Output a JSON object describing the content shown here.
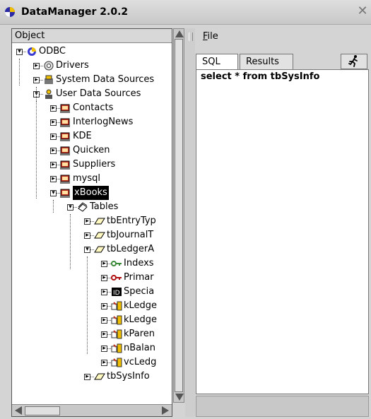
{
  "window": {
    "title": "DataManager 2.0.2",
    "close_glyph": "✕"
  },
  "tree": {
    "header": "Object",
    "nodes": [
      {
        "label": "ODBC",
        "icon": "odbc-globe-icon",
        "toggle": "−"
      },
      {
        "label": "Drivers",
        "icon": "drivers-gear-icon",
        "toggle": "+"
      },
      {
        "label": "System Data Sources",
        "icon": "system-datasource-icon",
        "toggle": "+"
      },
      {
        "label": "User Data Sources",
        "icon": "user-datasource-icon",
        "toggle": "−"
      },
      {
        "label": "Contacts",
        "icon": "database-icon",
        "toggle": "+"
      },
      {
        "label": "InterlogNews",
        "icon": "database-icon",
        "toggle": "+"
      },
      {
        "label": "KDE",
        "icon": "database-icon",
        "toggle": "+"
      },
      {
        "label": "Quicken",
        "icon": "database-icon",
        "toggle": "+"
      },
      {
        "label": "Suppliers",
        "icon": "database-icon",
        "toggle": "+"
      },
      {
        "label": "mysql",
        "icon": "database-icon",
        "toggle": "+"
      },
      {
        "label": "xBooks",
        "icon": "database-icon",
        "toggle": "−",
        "selected": true
      },
      {
        "label": "Tables",
        "icon": "tables-icon",
        "toggle": "−"
      },
      {
        "label": "tbEntryTyp",
        "icon": "table-icon",
        "toggle": "+"
      },
      {
        "label": "tbJournalT",
        "icon": "table-icon",
        "toggle": "+"
      },
      {
        "label": "tbLedgerA",
        "icon": "table-icon",
        "toggle": "−"
      },
      {
        "label": "Indexs",
        "icon": "index-key-icon",
        "toggle": "+"
      },
      {
        "label": "Primar",
        "icon": "primary-key-icon",
        "toggle": "+"
      },
      {
        "label": "Specia",
        "icon": "id-icon",
        "toggle": "+"
      },
      {
        "label": "kLedge",
        "icon": "column-icon",
        "toggle": "+"
      },
      {
        "label": "kLedge",
        "icon": "column-icon",
        "toggle": "+"
      },
      {
        "label": "kParen",
        "icon": "column-icon",
        "toggle": "+"
      },
      {
        "label": "nBalan",
        "icon": "column-icon",
        "toggle": "+"
      },
      {
        "label": "vcLedg",
        "icon": "column-icon",
        "toggle": "+"
      },
      {
        "label": "tbSysInfo",
        "icon": "table-icon",
        "toggle": "+"
      }
    ]
  },
  "menu": {
    "file": "File",
    "file_mnemonic": "F",
    "file_rest": "ile"
  },
  "tabs": {
    "sql": "SQL",
    "results": "Results",
    "run_icon": "running-man-icon"
  },
  "editor": {
    "text": "select * from tbSysInfo"
  },
  "colors": {
    "selection": "#000000",
    "background": "#d4d4d4",
    "panel": "#ffffff"
  }
}
